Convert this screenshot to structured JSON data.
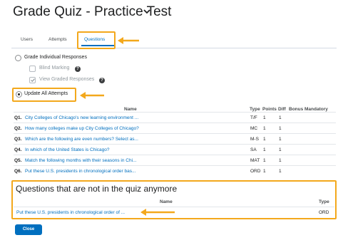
{
  "page": {
    "title": "Grade Quiz - Practice Test",
    "title_icon": "chevron-down-icon"
  },
  "tabs": [
    {
      "label": "Users",
      "active": false
    },
    {
      "label": "Attempts",
      "active": false
    },
    {
      "label": "Questions",
      "active": true
    }
  ],
  "options": {
    "grade_individual": {
      "label": "Grade Individual Responses",
      "selected": false
    },
    "blind_marking": {
      "label": "Blind Marking",
      "checked": false,
      "enabled": false
    },
    "view_graded": {
      "label": "View Graded Responses",
      "checked": true,
      "enabled": false
    },
    "update_all": {
      "label": "Update All Attempts",
      "selected": true
    }
  },
  "questions_table": {
    "columns": [
      "Name",
      "Type",
      "Points",
      "Diff",
      "Bonus",
      "Mandatory"
    ],
    "rows": [
      {
        "num": "Q1.",
        "name": "City Colleges of Chicago's new learning environment ...",
        "type": "T/F",
        "points": "1",
        "diff": "1"
      },
      {
        "num": "Q2.",
        "name": "How many colleges make up City Colleges of Chicago?",
        "type": "MC",
        "points": "1",
        "diff": "1"
      },
      {
        "num": "Q3.",
        "name": "Which are the following are even numbers? Select as...",
        "type": "M-S",
        "points": "1",
        "diff": "1"
      },
      {
        "num": "Q4.",
        "name": "In which of the United States is Chicago?",
        "type": "SA",
        "points": "1",
        "diff": "1"
      },
      {
        "num": "Q5.",
        "name": "Match the following months with their seasons in Chi...",
        "type": "MAT",
        "points": "1",
        "diff": "1"
      },
      {
        "num": "Q6.",
        "name": "Put these U.S. presidents in chronological order bas...",
        "type": "ORD",
        "points": "1",
        "diff": "1"
      }
    ]
  },
  "removed": {
    "title": "Questions that are not in the quiz anymore",
    "columns": [
      "Name",
      "Type"
    ],
    "rows": [
      {
        "name": "Put these U.S. presidents in chronological order of ...",
        "type": "ORD"
      }
    ]
  },
  "buttons": {
    "close": "Close"
  },
  "colors": {
    "accent": "#006fbf",
    "highlight": "#f3a81c"
  }
}
